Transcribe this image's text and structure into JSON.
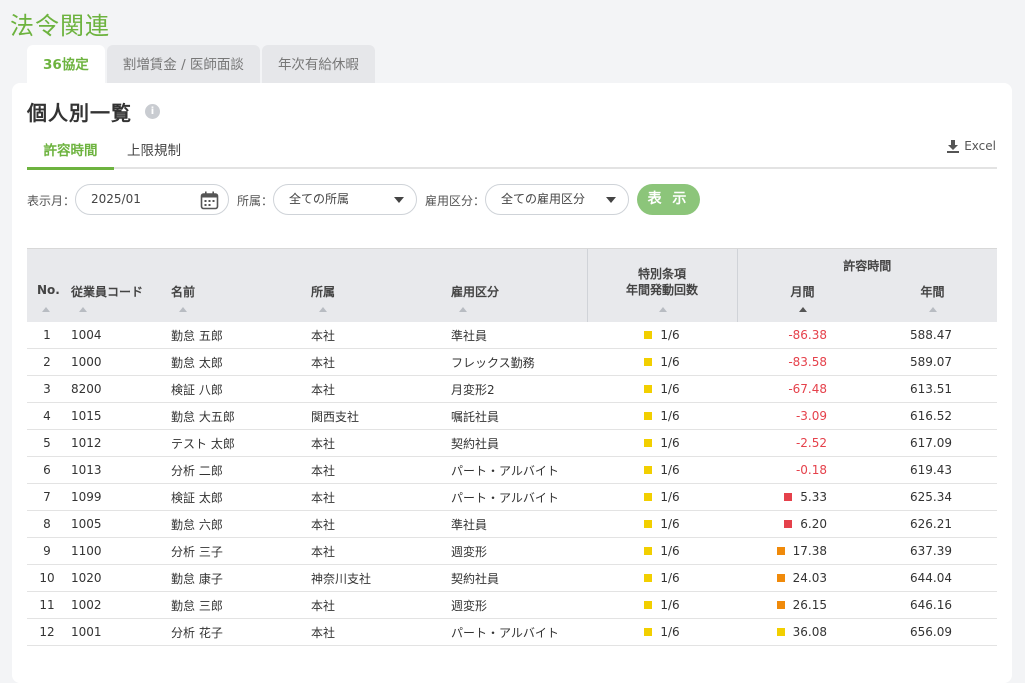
{
  "page_title": "法令関連",
  "tabs": [
    {
      "label": "36協定",
      "active": true
    },
    {
      "label": "割増賃金 / 医師面談",
      "active": false
    },
    {
      "label": "年次有給休暇",
      "active": false
    }
  ],
  "section_title": "個人別一覧",
  "info_icon": "info-icon",
  "subtabs": [
    {
      "label": "許容時間",
      "active": true
    },
    {
      "label": "上限規制",
      "active": false
    }
  ],
  "excel_label": "Excel",
  "filters": {
    "month_label": "表示月：",
    "month_value": "2025/01",
    "dept_label": "所属：",
    "dept_value": "全ての所属",
    "emp_type_label": "雇用区分：",
    "emp_type_value": "全ての雇用区分",
    "show_button": "表 示"
  },
  "table": {
    "headers": {
      "no": "No.",
      "code": "従業員コード",
      "name": "名前",
      "dept": "所属",
      "emp_type": "雇用区分",
      "special_1": "特別条項",
      "special_2": "年間発動回数",
      "allow_group": "許容時間",
      "monthly": "月間",
      "annual": "年間"
    },
    "status_colors": {
      "yellow": "#f2cf00",
      "orange": "#f08a0a",
      "red": "#e5414b"
    },
    "rows": [
      {
        "no": "1",
        "code": "1004",
        "name": "勤怠 五郎",
        "dept": "本社",
        "emp_type": "準社員",
        "special_status": "yellow",
        "special": "1/6",
        "monthly": "-86.38",
        "monthly_status": "negative",
        "annual": "588.47"
      },
      {
        "no": "2",
        "code": "1000",
        "name": "勤怠 太郎",
        "dept": "本社",
        "emp_type": "フレックス勤務",
        "special_status": "yellow",
        "special": "1/6",
        "monthly": "-83.58",
        "monthly_status": "negative",
        "annual": "589.07"
      },
      {
        "no": "3",
        "code": "8200",
        "name": "検証 八郎",
        "dept": "本社",
        "emp_type": "月変形2",
        "special_status": "yellow",
        "special": "1/6",
        "monthly": "-67.48",
        "monthly_status": "negative",
        "annual": "613.51"
      },
      {
        "no": "4",
        "code": "1015",
        "name": "勤怠 大五郎",
        "dept": "関西支社",
        "emp_type": "嘱託社員",
        "special_status": "yellow",
        "special": "1/6",
        "monthly": "-3.09",
        "monthly_status": "negative",
        "annual": "616.52"
      },
      {
        "no": "5",
        "code": "1012",
        "name": "テスト 太郎",
        "dept": "本社",
        "emp_type": "契約社員",
        "special_status": "yellow",
        "special": "1/6",
        "monthly": "-2.52",
        "monthly_status": "negative",
        "annual": "617.09"
      },
      {
        "no": "6",
        "code": "1013",
        "name": "分析 二郎",
        "dept": "本社",
        "emp_type": "パート・アルバイト",
        "special_status": "yellow",
        "special": "1/6",
        "monthly": "-0.18",
        "monthly_status": "negative",
        "annual": "619.43"
      },
      {
        "no": "7",
        "code": "1099",
        "name": "検証 太郎",
        "dept": "本社",
        "emp_type": "パート・アルバイト",
        "special_status": "yellow",
        "special": "1/6",
        "monthly": "5.33",
        "monthly_status": "red",
        "annual": "625.34"
      },
      {
        "no": "8",
        "code": "1005",
        "name": "勤怠 六郎",
        "dept": "本社",
        "emp_type": "準社員",
        "special_status": "yellow",
        "special": "1/6",
        "monthly": "6.20",
        "monthly_status": "red",
        "annual": "626.21"
      },
      {
        "no": "9",
        "code": "1100",
        "name": "分析 三子",
        "dept": "本社",
        "emp_type": "週変形",
        "special_status": "yellow",
        "special": "1/6",
        "monthly": "17.38",
        "monthly_status": "orange",
        "annual": "637.39"
      },
      {
        "no": "10",
        "code": "1020",
        "name": "勤怠 康子",
        "dept": "神奈川支社",
        "emp_type": "契約社員",
        "special_status": "yellow",
        "special": "1/6",
        "monthly": "24.03",
        "monthly_status": "orange",
        "annual": "644.04"
      },
      {
        "no": "11",
        "code": "1002",
        "name": "勤怠 三郎",
        "dept": "本社",
        "emp_type": "週変形",
        "special_status": "yellow",
        "special": "1/6",
        "monthly": "26.15",
        "monthly_status": "orange",
        "annual": "646.16"
      },
      {
        "no": "12",
        "code": "1001",
        "name": "分析 花子",
        "dept": "本社",
        "emp_type": "パート・アルバイト",
        "special_status": "yellow",
        "special": "1/6",
        "monthly": "36.08",
        "monthly_status": "yellow",
        "annual": "656.09"
      }
    ]
  }
}
